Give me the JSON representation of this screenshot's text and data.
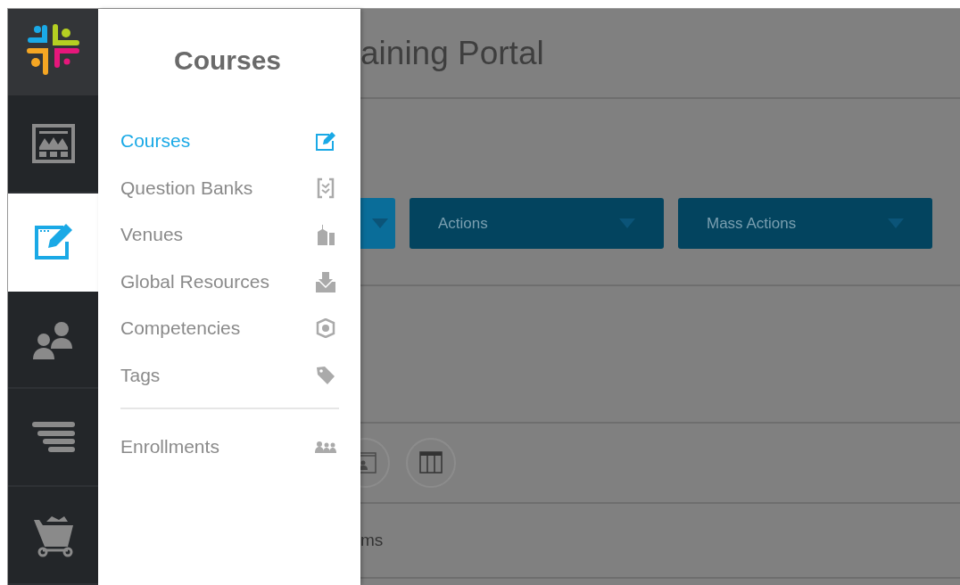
{
  "rail": {
    "items": [
      {
        "kind": "dashboard",
        "selected": false
      },
      {
        "kind": "courses",
        "selected": true
      },
      {
        "kind": "users",
        "selected": false
      },
      {
        "kind": "list",
        "selected": false
      },
      {
        "kind": "cart",
        "selected": false
      }
    ]
  },
  "menu": {
    "title": "Courses",
    "sections": [
      {
        "items": [
          {
            "label": "Courses",
            "kind": "edit",
            "selected": true
          },
          {
            "label": "Question Banks",
            "kind": "checklist",
            "selected": false
          },
          {
            "label": "Venues",
            "kind": "building",
            "selected": false
          },
          {
            "label": "Global Resources",
            "kind": "download",
            "selected": false
          },
          {
            "label": "Competencies",
            "kind": "badge",
            "selected": false
          },
          {
            "label": "Tags",
            "kind": "tag",
            "selected": false
          }
        ]
      },
      {
        "items": [
          {
            "label": "Enrollments",
            "kind": "people",
            "selected": false
          }
        ]
      }
    ]
  },
  "main": {
    "title": "aining Portal",
    "buttons": [
      {
        "label": "Actions"
      },
      {
        "label": "Mass Actions"
      }
    ],
    "views": [
      {
        "kind": "gallery"
      },
      {
        "kind": "table"
      }
    ],
    "text": "ms"
  }
}
